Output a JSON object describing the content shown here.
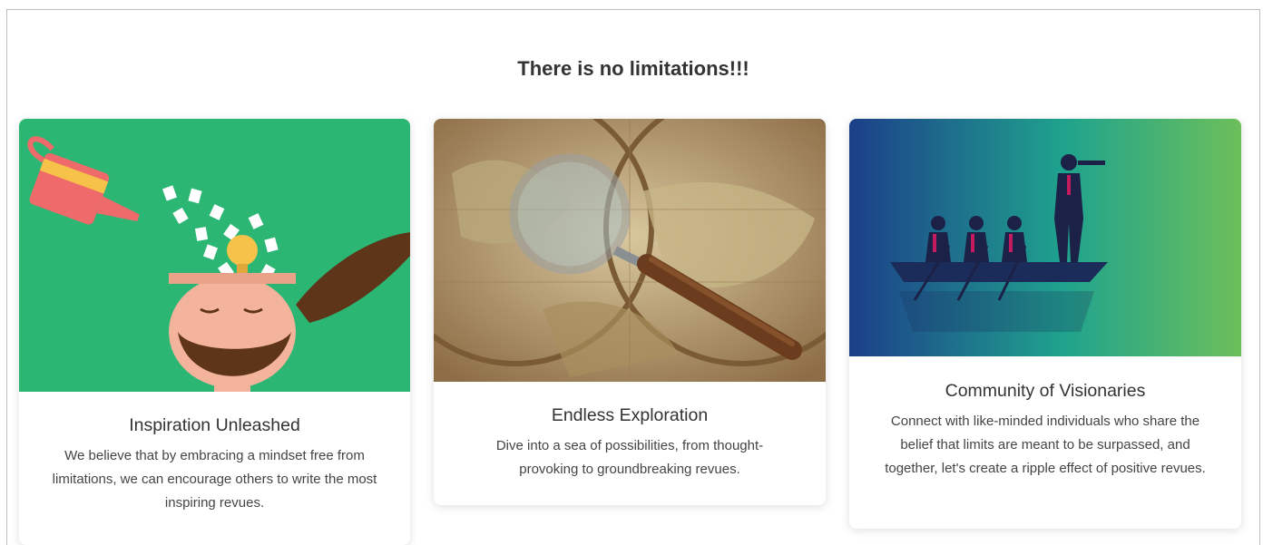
{
  "section": {
    "title": "There is no limitations!!!"
  },
  "cards": [
    {
      "title": "Inspiration Unleashed",
      "text": "We believe that by embracing a mindset free from limitations, we can encourage others to write the most inspiring revues.",
      "image_icon": "idea-head-illustration",
      "background": "#2bb673"
    },
    {
      "title": "Endless Exploration",
      "text": "Dive into a sea of possibilities, from thought-provoking to groundbreaking revues.",
      "image_icon": "magnifier-map-illustration",
      "background": "#b49a6a"
    },
    {
      "title": "Community of Visionaries",
      "text": "Connect with like-minded individuals who share the belief that limits are meant to be surpassed, and together, let's create a ripple effect of positive revues.",
      "image_icon": "rowing-team-illustration",
      "background_from": "#1c3f8a",
      "background_to": "#6cbf5a"
    }
  ]
}
